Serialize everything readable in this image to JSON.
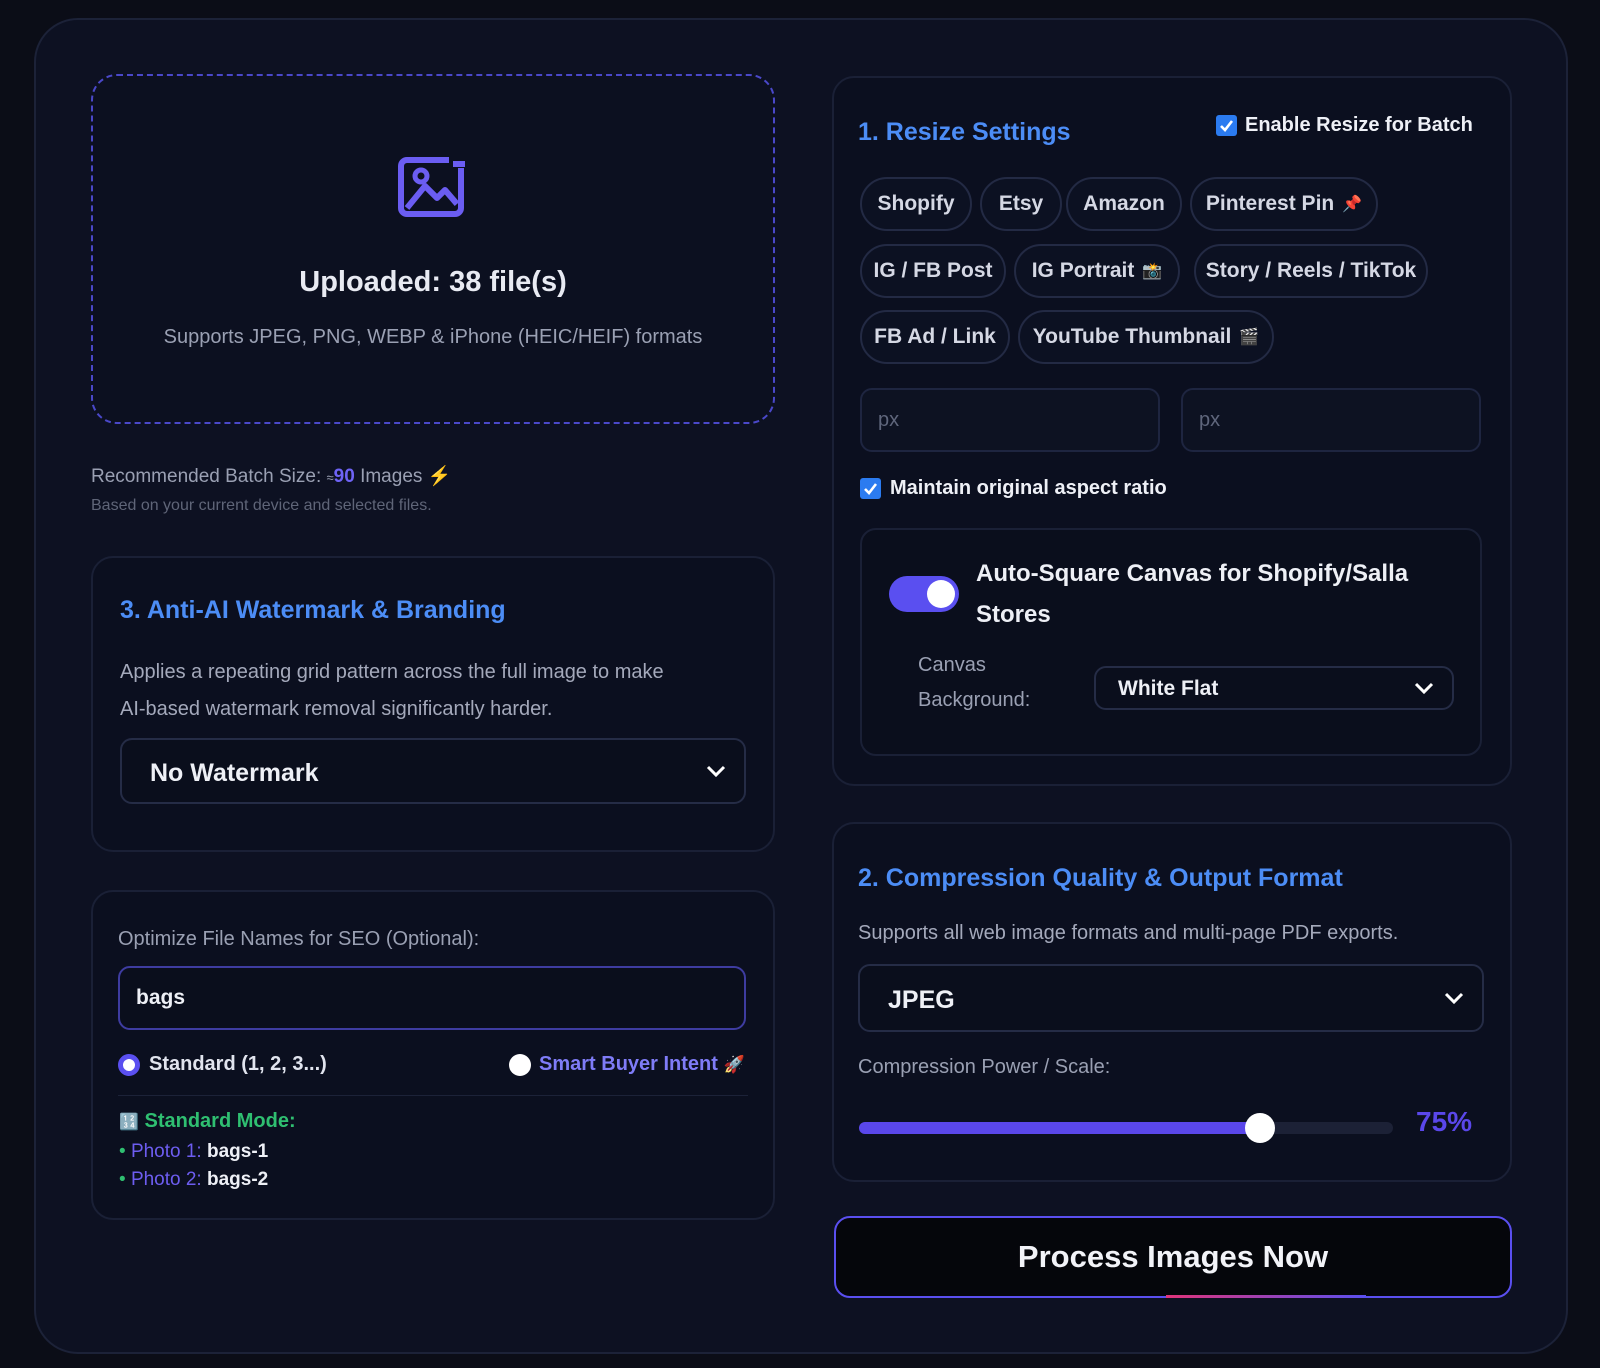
{
  "upload": {
    "title": "Uploaded: 38 file(s)",
    "subtitle": "Supports JPEG, PNG, WEBP & iPhone (HEIC/HEIF) formats",
    "icon": "image-icon"
  },
  "recommendation": {
    "prefix": "Recommended Batch Size:",
    "approx": "≈",
    "count": "90",
    "suffix": "Images",
    "bolt": "⚡",
    "note": "Based on your current device and selected files."
  },
  "watermark": {
    "title": "3. Anti-AI Watermark & Branding",
    "description_line1": "Applies a repeating grid pattern across the full image to make",
    "description_line2": "AI-based watermark removal significantly harder.",
    "selected": "No Watermark"
  },
  "seo": {
    "label": "Optimize File Names for SEO (Optional):",
    "value": "bags",
    "option_standard": "Standard (1, 2, 3...)",
    "option_smart": "Smart Buyer Intent",
    "option_smart_emoji": "🚀",
    "mode_icon": "🔢",
    "mode_label": "Standard Mode:",
    "preview": [
      {
        "label": "Photo 1:",
        "value": "bags-1"
      },
      {
        "label": "Photo 2:",
        "value": "bags-2"
      }
    ]
  },
  "resize": {
    "title": "1. Resize Settings",
    "enable_label": "Enable Resize for Batch",
    "enable_checked": true,
    "presets": [
      {
        "label": "Shopify",
        "emoji": ""
      },
      {
        "label": "Etsy",
        "emoji": ""
      },
      {
        "label": "Amazon",
        "emoji": ""
      },
      {
        "label": "Pinterest Pin",
        "emoji": "📌"
      },
      {
        "label": "IG / FB Post",
        "emoji": ""
      },
      {
        "label": "IG Portrait",
        "emoji": "📸"
      },
      {
        "label": "Story / Reels / TikTok",
        "emoji": ""
      },
      {
        "label": "FB Ad / Link",
        "emoji": ""
      },
      {
        "label": "YouTube Thumbnail",
        "emoji": "🎬"
      }
    ],
    "width_placeholder": "px",
    "height_placeholder": "px",
    "aspect_label": "Maintain original aspect ratio",
    "aspect_checked": true,
    "autosquare_line1": "Auto-Square Canvas for Shopify/Salla",
    "autosquare_line2": "Stores",
    "autosquare_enabled": true,
    "canvas_label_line1": "Canvas",
    "canvas_label_line2": "Background:",
    "canvas_bg": "White Flat"
  },
  "compression": {
    "title": "2. Compression Quality & Output Format",
    "description": "Supports all web image formats and multi-page PDF exports.",
    "format": "JPEG",
    "scale_label": "Compression Power / Scale:",
    "scale_value": 75,
    "scale_text": "75%"
  },
  "actions": {
    "process_label": "Process Images Now"
  },
  "colors": {
    "accent_blue": "#4c8df6",
    "accent_purple": "#5a4ff0",
    "green": "#2fbf71",
    "background": "#0d1122"
  }
}
